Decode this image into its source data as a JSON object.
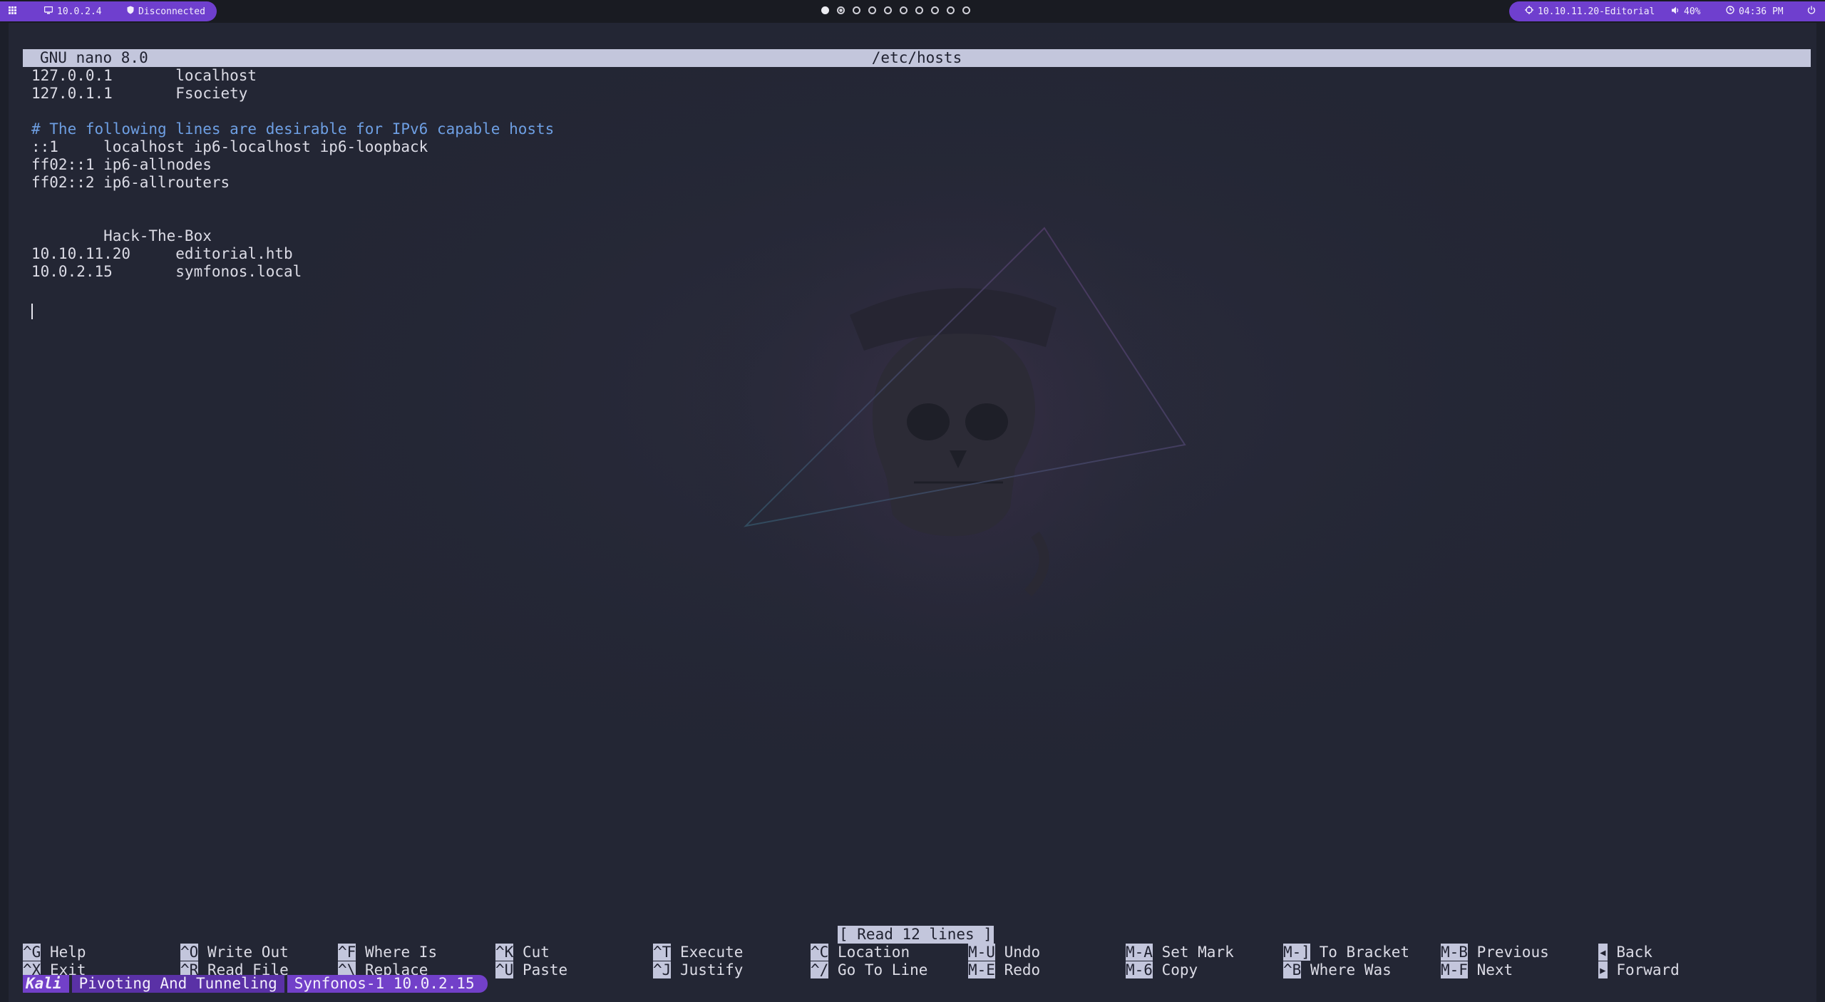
{
  "topbar": {
    "left": {
      "menu_icon": "grid-icon",
      "ip_icon": "monitor-icon",
      "ip": "10.0.2.4",
      "vpn_icon": "shield-icon",
      "vpn_status": "Disconnected"
    },
    "workspaces": {
      "count": 10,
      "active_index": 0,
      "occupied_index": 1
    },
    "right": {
      "target_icon": "target-icon",
      "target": "10.10.11.20-Editorial",
      "volume_icon": "speaker-icon",
      "volume": "40%",
      "clock_icon": "clock-icon",
      "time": "04:36 PM",
      "power_icon": "power-icon"
    }
  },
  "nano": {
    "version": "GNU nano 8.0",
    "filename": "/etc/hosts",
    "lines": [
      {
        "text": "127.0.0.1       localhost",
        "type": "text"
      },
      {
        "text": "127.0.1.1       Fsociety",
        "type": "text"
      },
      {
        "text": "",
        "type": "text"
      },
      {
        "text": "# The following lines are desirable for IPv6 capable hosts",
        "type": "comment"
      },
      {
        "text": "::1     localhost ip6-localhost ip6-loopback",
        "type": "text"
      },
      {
        "text": "ff02::1 ip6-allnodes",
        "type": "text"
      },
      {
        "text": "ff02::2 ip6-allrouters",
        "type": "text"
      },
      {
        "text": "",
        "type": "text"
      },
      {
        "text": "",
        "type": "text"
      },
      {
        "text": "        Hack-The-Box",
        "type": "text"
      },
      {
        "text": "10.10.11.20     editorial.htb",
        "type": "text"
      },
      {
        "text": "10.0.2.15       symfonos.local",
        "type": "text"
      }
    ],
    "status": "[ Read 12 lines ]",
    "shortcuts": [
      {
        "key": "^G",
        "label": "Help"
      },
      {
        "key": "^X",
        "label": "Exit"
      },
      {
        "key": "^O",
        "label": "Write Out"
      },
      {
        "key": "^R",
        "label": "Read File"
      },
      {
        "key": "^F",
        "label": "Where Is"
      },
      {
        "key": "^\\",
        "label": "Replace"
      },
      {
        "key": "^K",
        "label": "Cut"
      },
      {
        "key": "^U",
        "label": "Paste"
      },
      {
        "key": "^T",
        "label": "Execute"
      },
      {
        "key": "^J",
        "label": "Justify"
      },
      {
        "key": "^C",
        "label": "Location"
      },
      {
        "key": "^/",
        "label": "Go To Line"
      },
      {
        "key": "M-U",
        "label": "Undo"
      },
      {
        "key": "M-E",
        "label": "Redo"
      },
      {
        "key": "M-A",
        "label": "Set Mark"
      },
      {
        "key": "M-6",
        "label": "Copy"
      },
      {
        "key": "M-]",
        "label": "To Bracket"
      },
      {
        "key": "^B",
        "label": "Where Was"
      },
      {
        "key": "M-B",
        "label": "Previous"
      },
      {
        "key": "M-F",
        "label": "Next"
      },
      {
        "key": "◂",
        "label": "Back"
      },
      {
        "key": "▸",
        "label": "Forward"
      }
    ]
  },
  "tmux": {
    "session": "Kali",
    "windows": [
      "Pivoting And Tunneling",
      "Synfonos-1 10.0.2.15"
    ]
  }
}
